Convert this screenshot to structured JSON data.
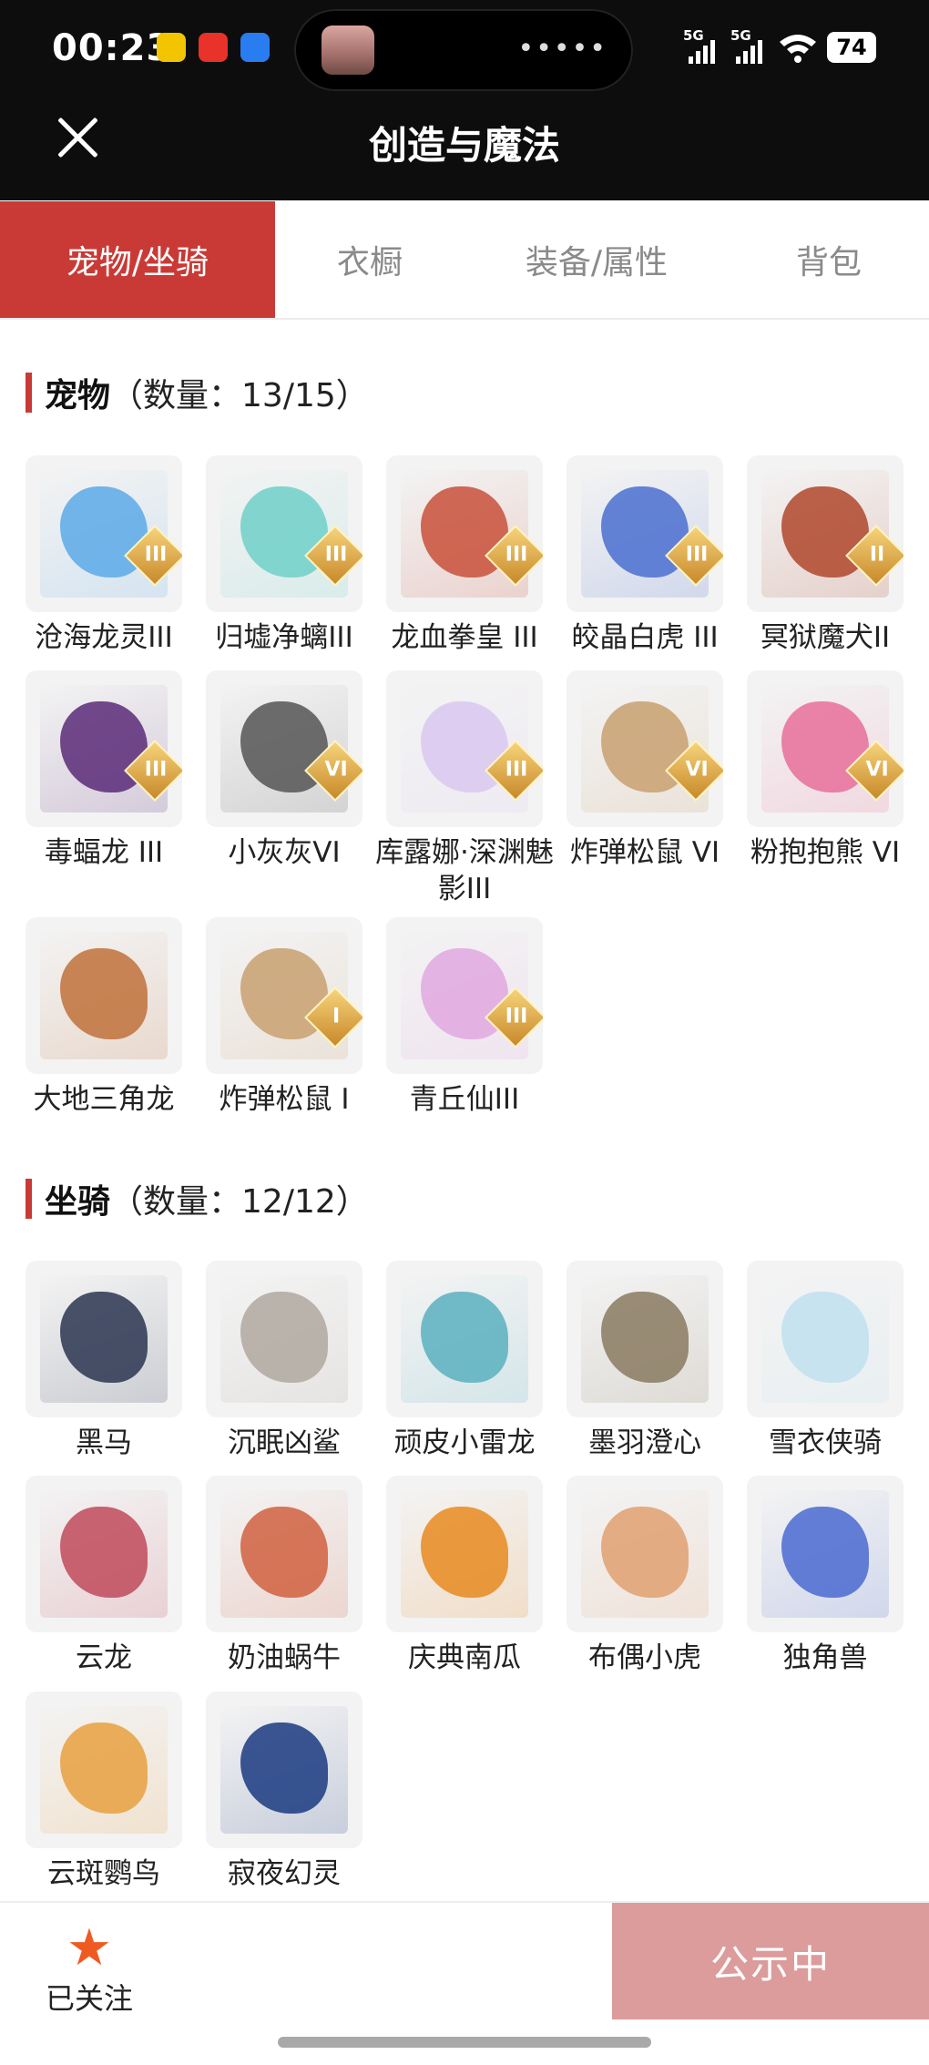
{
  "status_bar": {
    "time": "00:23",
    "network1": "5G",
    "network2": "5G",
    "battery": "74"
  },
  "header": {
    "title": "创造与魔法"
  },
  "tabs": [
    "宠物/坐骑",
    "衣橱",
    "装备/属性",
    "背包"
  ],
  "pets": {
    "label": "宠物",
    "count": "（数量：13/15）",
    "items": [
      {
        "name": "沧海龙灵III",
        "badge": "III",
        "color": "#5aa9e8"
      },
      {
        "name": "归墟净螭III",
        "badge": "III",
        "color": "#6fd0c8"
      },
      {
        "name": "龙血拳皇 III",
        "badge": "III",
        "color": "#c8503a"
      },
      {
        "name": "皎晶白虎 III",
        "badge": "III",
        "color": "#4a6fd0"
      },
      {
        "name": "冥狱魔犬II",
        "badge": "II",
        "color": "#b0472c"
      },
      {
        "name": "毒蝠龙 III",
        "badge": "III",
        "color": "#5a2a78"
      },
      {
        "name": "小灰灰VI",
        "badge": "VI",
        "color": "#555555"
      },
      {
        "name": "库露娜·深渊魅影III",
        "badge": "III",
        "color": "#d9c8f0"
      },
      {
        "name": "炸弹松鼠 VI",
        "badge": "VI",
        "color": "#c8a070"
      },
      {
        "name": "粉抱抱熊 VI",
        "badge": "VI",
        "color": "#e86f9a"
      },
      {
        "name": "大地三角龙",
        "badge": "",
        "color": "#c0713a"
      },
      {
        "name": "炸弹松鼠 I",
        "badge": "I",
        "color": "#c8a070"
      },
      {
        "name": "青丘仙III",
        "badge": "III",
        "color": "#e0a8e0"
      }
    ]
  },
  "mounts": {
    "label": "坐骑",
    "count": "（数量：12/12）",
    "items": [
      {
        "name": "黑马",
        "badge": "",
        "color": "#2a3550"
      },
      {
        "name": "沉眠凶鲨",
        "badge": "",
        "color": "#b0a8a0"
      },
      {
        "name": "顽皮小雷龙",
        "badge": "",
        "color": "#5ab0c0"
      },
      {
        "name": "墨羽澄心",
        "badge": "",
        "color": "#8a7a60"
      },
      {
        "name": "雪衣侠骑",
        "badge": "",
        "color": "#c0e0ee"
      },
      {
        "name": "云龙",
        "badge": "",
        "color": "#c04a5a"
      },
      {
        "name": "奶油蜗牛",
        "badge": "",
        "color": "#d06040"
      },
      {
        "name": "庆典南瓜",
        "badge": "",
        "color": "#e88a20"
      },
      {
        "name": "布偶小虎",
        "badge": "",
        "color": "#e0a070"
      },
      {
        "name": "独角兽",
        "badge": "",
        "color": "#4a6ad0"
      },
      {
        "name": "云斑鹦鸟",
        "badge": "",
        "color": "#e8a040"
      },
      {
        "name": "寂夜幻灵",
        "badge": "",
        "color": "#1a3a80"
      }
    ]
  },
  "bottom": {
    "follow_label": "已关注",
    "public_label": "公示中"
  }
}
